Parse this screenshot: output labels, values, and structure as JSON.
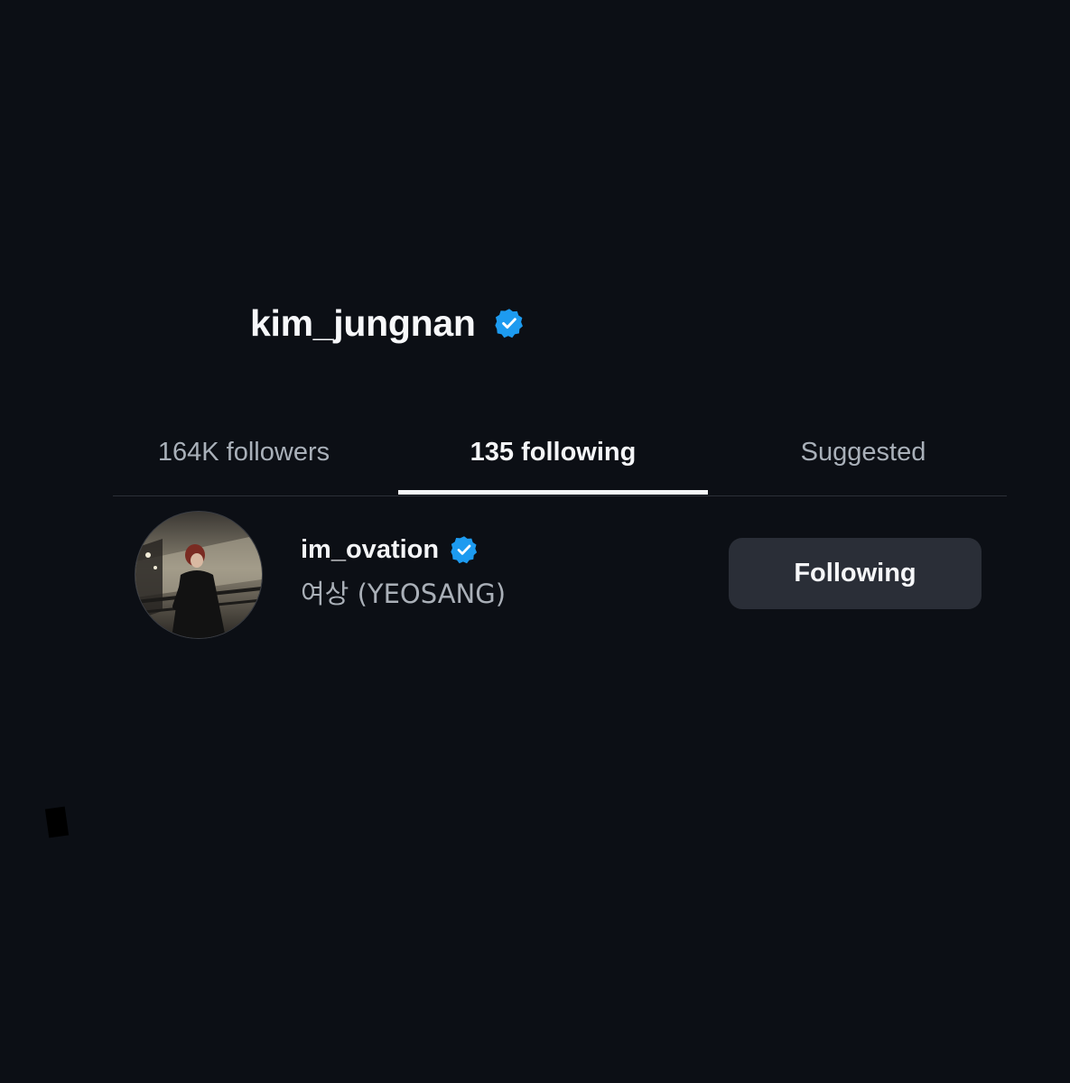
{
  "profile": {
    "username": "kim_jungnan",
    "verified": true
  },
  "tabs": [
    {
      "label": "164K followers",
      "active": false
    },
    {
      "label": "135 following",
      "active": true
    },
    {
      "label": "Suggested",
      "active": false
    }
  ],
  "following_list": [
    {
      "username": "im_ovation",
      "full_name": "여상 (YEOSANG)",
      "verified": true,
      "button_label": "Following"
    }
  ],
  "colors": {
    "background": "#0c0f15",
    "verified_badge": "#1d9bf0",
    "button_bg": "#2a2e37",
    "secondary_text": "#aab0b8"
  },
  "icons": {
    "verified": "verified-badge-icon"
  }
}
